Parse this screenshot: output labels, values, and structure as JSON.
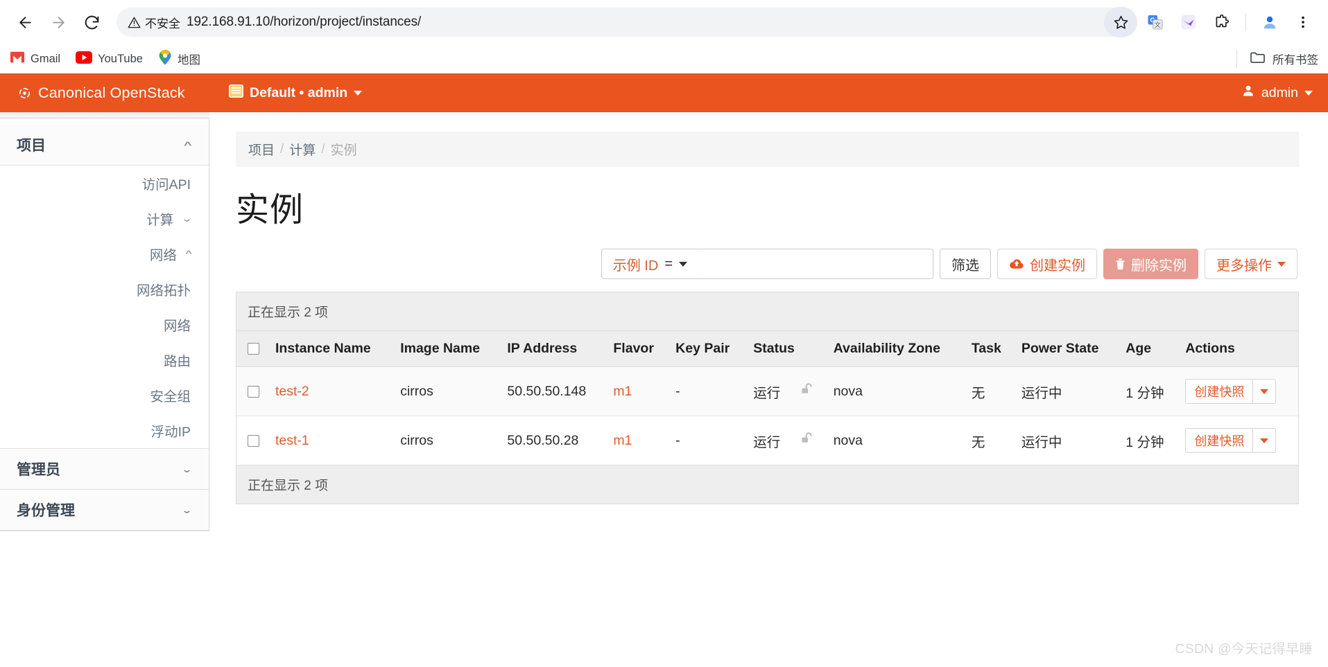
{
  "browser": {
    "back_icon": "back-arrow-icon",
    "forward_icon": "forward-arrow-icon",
    "reload_icon": "reload-icon",
    "security_label": "不安全",
    "url": "192.168.91.10/horizon/project/instances/",
    "bookmarks": [
      {
        "label": "Gmail",
        "icon": "gmail-icon"
      },
      {
        "label": "YouTube",
        "icon": "youtube-icon"
      },
      {
        "label": "地图",
        "icon": "maps-pin-icon"
      }
    ],
    "all_bookmarks_label": "所有书签"
  },
  "topbar": {
    "brand": "Canonical OpenStack",
    "context": "Default • admin",
    "user": "admin"
  },
  "sidebar": {
    "groups": [
      {
        "label": "项目",
        "expanded": true,
        "items": [
          {
            "label": "访问API",
            "level": 2,
            "has_chevron": false
          },
          {
            "label": "计算",
            "level": 1,
            "has_chevron": true,
            "expanded": false
          },
          {
            "label": "网络",
            "level": 1,
            "has_chevron": true,
            "expanded": true
          },
          {
            "label": "网络拓扑",
            "level": 2,
            "has_chevron": false
          },
          {
            "label": "网络",
            "level": 2,
            "has_chevron": false
          },
          {
            "label": "路由",
            "level": 2,
            "has_chevron": false
          },
          {
            "label": "安全组",
            "level": 2,
            "has_chevron": false
          },
          {
            "label": "浮动IP",
            "level": 2,
            "has_chevron": false
          }
        ]
      }
    ],
    "bottom_groups": [
      {
        "label": "管理员",
        "expanded": false
      },
      {
        "label": "身份管理",
        "expanded": false
      }
    ]
  },
  "breadcrumb": {
    "items": [
      "项目",
      "计算",
      "实例"
    ],
    "separator": "/"
  },
  "page": {
    "title": "实例"
  },
  "toolbar": {
    "filter_field_label": "示例 ID",
    "filter_operator": "=",
    "filter_input_value": "",
    "filter_input_placeholder": "",
    "filter_button": "筛选",
    "create_button": "创建实例",
    "delete_button": "删除实例",
    "more_button": "更多操作"
  },
  "table": {
    "caption": "正在显示 2 项",
    "footer": "正在显示 2 项",
    "columns": [
      "Instance Name",
      "Image Name",
      "IP Address",
      "Flavor",
      "Key Pair",
      "Status",
      "Availability Zone",
      "Task",
      "Power State",
      "Age",
      "Actions"
    ],
    "action_label": "创建快照",
    "rows": [
      {
        "name": "test-2",
        "image": "cirros",
        "ip": "50.50.50.148",
        "flavor": "m1",
        "keypair": "-",
        "status": "运行",
        "lock": "unlocked-icon",
        "az": "nova",
        "task": "无",
        "power": "运行中",
        "age": "1 分钟"
      },
      {
        "name": "test-1",
        "image": "cirros",
        "ip": "50.50.50.28",
        "flavor": "m1",
        "keypair": "-",
        "status": "运行",
        "lock": "unlocked-icon",
        "az": "nova",
        "task": "无",
        "power": "运行中",
        "age": "1 分钟"
      }
    ]
  },
  "watermark": "CSDN @今天记得早睡",
  "colors": {
    "brand_orange": "#e9541f",
    "link_orange": "#e05b2a",
    "danger": "#e79b93"
  }
}
